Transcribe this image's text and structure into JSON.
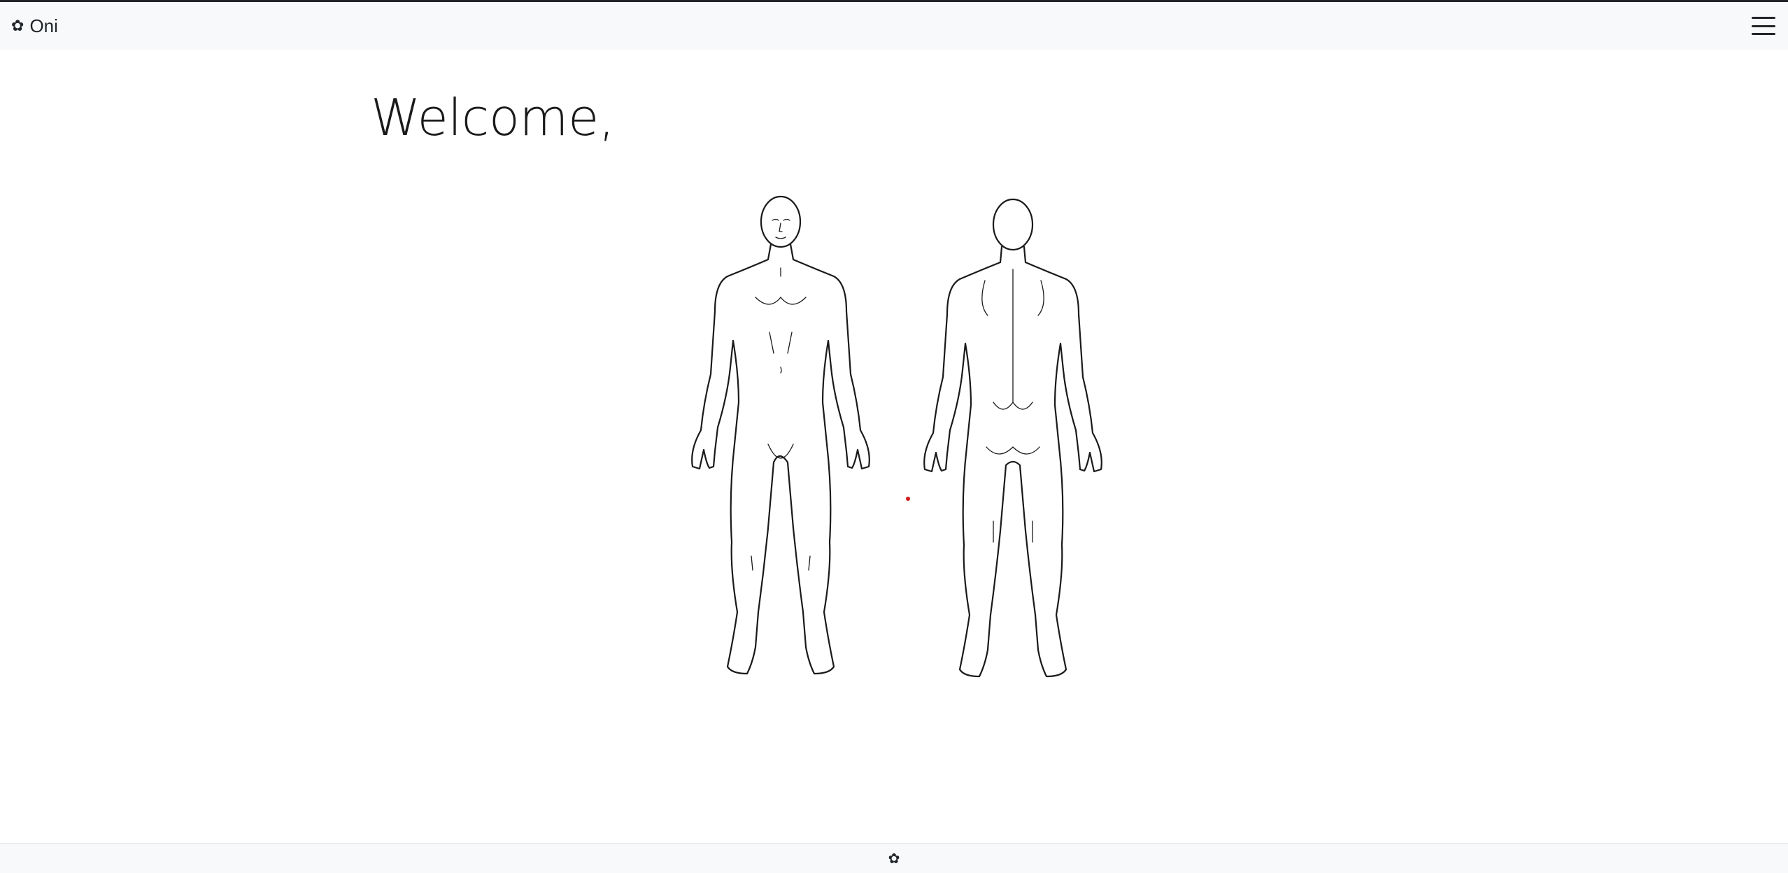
{
  "navbar": {
    "brand_icon": "✿",
    "brand_label": "Oni",
    "menu_icon": "hamburger-menu-icon"
  },
  "main": {
    "welcome_text": "Welcome,",
    "body_diagram": {
      "views": [
        "front-view",
        "back-view"
      ],
      "marker_color": "#d11a1a"
    }
  },
  "footer": {
    "icon": "✿"
  },
  "colors": {
    "navbar_bg": "#f8f9fa",
    "text": "#212529",
    "marker": "#d11a1a"
  }
}
